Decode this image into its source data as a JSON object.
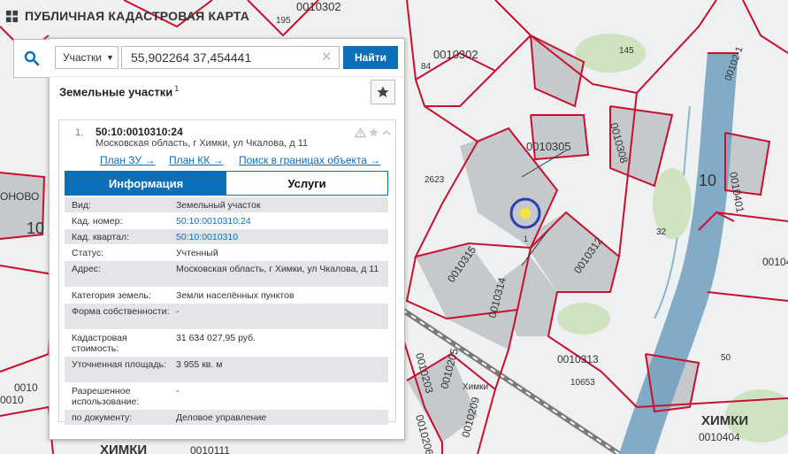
{
  "app": {
    "title": "ПУБЛИЧНАЯ КАДАСТРОВАЯ КАРТА"
  },
  "search": {
    "type_value": "Участки",
    "query": "55,902264 37,454441",
    "find_label": "Найти"
  },
  "results": {
    "title": "Земельные участки",
    "count": "1"
  },
  "parcel": {
    "index": "1.",
    "cad_number": "50:10:0010310:24",
    "address": "Московская область, г Химки, ул Чкалова, д 11",
    "links": {
      "plan_zu": "План ЗУ →",
      "plan_kk": "План КК →",
      "search_bounds": "Поиск в границах объекта →"
    },
    "tabs": {
      "info": "Информация",
      "services": "Услуги"
    },
    "rows": [
      {
        "key": "Вид:",
        "value": "Земельный участок"
      },
      {
        "key": "Кад. номер:",
        "value": "50:10:0010310:24"
      },
      {
        "key": "Кад. квартал:",
        "value": "50:10:0010310"
      },
      {
        "key": "Статус:",
        "value": "Учтенный"
      },
      {
        "key": "Адрес:",
        "value": "Московская область, г Химки, ул Чкалова, д 11"
      },
      {
        "key": "Категория земель:",
        "value": "Земли населённых пунктов"
      },
      {
        "key": "Форма собственности:",
        "value": "-"
      },
      {
        "key": "Кадастровая стоимость:",
        "value": "31 634 027,95 руб."
      },
      {
        "key": "Уточненная площадь:",
        "value": "3 955 кв. м"
      },
      {
        "key": "Разрешенное использование:",
        "value": "-"
      },
      {
        "key": "по документу:",
        "value": "Деловое управление"
      }
    ]
  },
  "map": {
    "labels": {
      "l1": "195",
      "l2": "0010302",
      "l3": "0010302",
      "l4": "84",
      "l5": "145",
      "l6": "0010305",
      "l7": "0010308",
      "l8": "ОНОВО",
      "l9": "10",
      "l10": "2623",
      "l11": "10",
      "l12": "0010401",
      "l13": "0010315",
      "l14": "0010312",
      "l15": "32",
      "l16": "00104",
      "l17": "0010314",
      "l18": "0010203",
      "l19": "0010205",
      "l20": "0010313",
      "l21": "10653",
      "l22": "Химки",
      "l23": "0010206",
      "l24": "0010209",
      "l25": "50",
      "l26": "ХИМКИ",
      "l27": "0010404",
      "l28": "0010",
      "l29": "0010111",
      "l30": "ХИМКИ",
      "l31": "1",
      "l32": "00102-1",
      "l33": "0010"
    }
  },
  "colors": {
    "accent": "#0a6fb8",
    "boundary": "#c8102e",
    "river": "#4f8fb8"
  }
}
